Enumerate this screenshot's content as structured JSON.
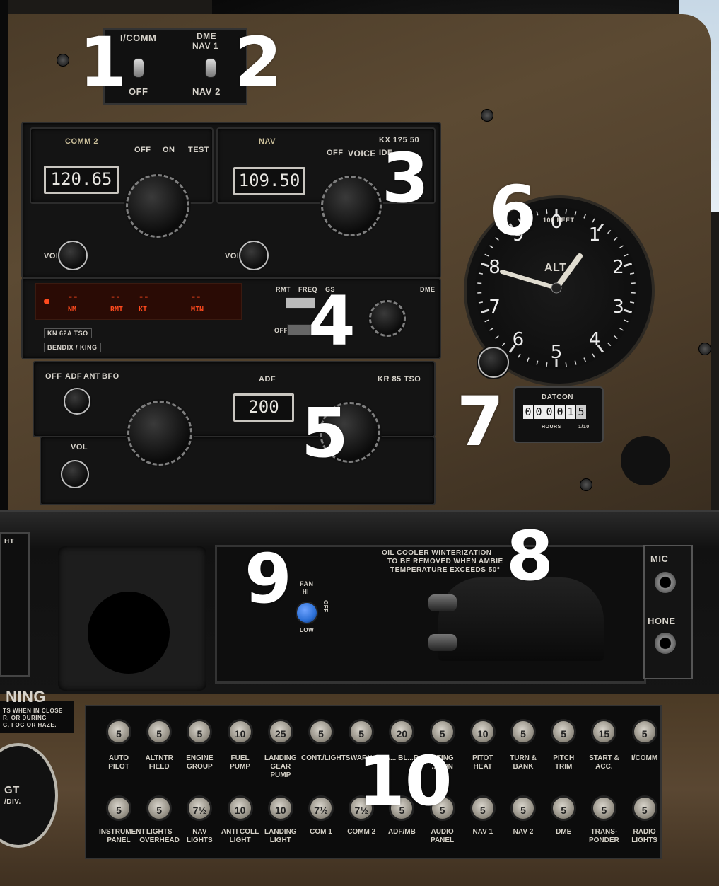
{
  "callouts": [
    "1",
    "2",
    "3",
    "4",
    "5",
    "6",
    "7",
    "8",
    "9",
    "10"
  ],
  "switch_plate": {
    "left_top": "I/COMM",
    "left_bottom": "OFF",
    "right_top1": "DME",
    "right_top2": "NAV 1",
    "right_bottom": "NAV 2"
  },
  "radio_kx": {
    "comm_label": "COMM 2",
    "comm_freq": "120.65",
    "nav_label": "NAV",
    "nav_freq": "109.50",
    "sw_off": "OFF",
    "sw_on": "ON",
    "sw_test": "TEST",
    "nav_off": "OFF",
    "nav_voice": "VOICE",
    "nav_ident": "IDE",
    "model": "KX 1?5 50",
    "vol1": "VOL",
    "vol2": "VOL"
  },
  "dme": {
    "seg1": "--",
    "seg2": "--",
    "seg3": "--",
    "seg4": "--",
    "u1": "NM",
    "u2": "RMT",
    "u3": "KT",
    "u4": "MIN",
    "rmt": "RMT",
    "freq": "FREQ",
    "gs": "GS",
    "title": "DME",
    "off": "OFF",
    "model": "KN 62A TSO",
    "brand": "BENDIX / KING"
  },
  "adf": {
    "modes_off": "OFF",
    "modes_adf": "ADF",
    "modes_ant": "ANT",
    "modes_bfo": "BFO",
    "title": "ADF",
    "freq": "200",
    "model": "KR 85 TSO",
    "vol": "VOL"
  },
  "altimeter": {
    "label": "ALT",
    "feet": "100 FEET",
    "nums": [
      "0",
      "1",
      "2",
      "3",
      "4",
      "5",
      "6",
      "7",
      "8",
      "9"
    ]
  },
  "hobbs": {
    "brand": "DATCON",
    "digits": [
      "0",
      "0",
      "0",
      "0",
      "1",
      "5"
    ],
    "hours": "HOURS",
    "tenths": "1/10"
  },
  "oil_cooler": {
    "line1": "OIL COOLER WINTERIZATION",
    "line2": "TO BE REMOVED WHEN AMBIE",
    "line3": "TEMPERATURE EXCEEDS 50°"
  },
  "fan": {
    "fan": "FAN",
    "hi": "HI",
    "low": "LOW",
    "off": "OFF"
  },
  "jacks": {
    "mic": "MIC",
    "phone": "HONE"
  },
  "warning": {
    "title": "NING",
    "line1": "TS WHEN IN CLOSE",
    "line2": "R, OR DURING",
    "line3": "G, FOG OR HAZE."
  },
  "egt": {
    "label": "GT",
    "sub": "/DIV."
  },
  "left_tag": "HT",
  "breakers_row1": [
    {
      "v": "5",
      "label": "AUTO PILOT"
    },
    {
      "v": "5",
      "label": "ALTNTR FIELD"
    },
    {
      "v": "5",
      "label": "ENGINE GROUP"
    },
    {
      "v": "10",
      "label": "FUEL PUMP"
    },
    {
      "v": "25",
      "label": "LANDING GEAR PUMP"
    },
    {
      "v": "5",
      "label": "CONT./LIGHTS"
    },
    {
      "v": "5",
      "label": "WARN"
    },
    {
      "v": "20",
      "label": "A... BL...R"
    },
    {
      "v": "5",
      "label": "...TING ...CON"
    },
    {
      "v": "10",
      "label": "PITOT HEAT"
    },
    {
      "v": "5",
      "label": "TURN & BANK"
    },
    {
      "v": "5",
      "label": "PITCH TRIM"
    },
    {
      "v": "15",
      "label": "START & ACC."
    },
    {
      "v": "5",
      "label": "I/COMM"
    }
  ],
  "breakers_row2": [
    {
      "v": "5",
      "label": "INSTRUMENT PANEL"
    },
    {
      "v": "5",
      "label": "LIGHTS OVERHEAD"
    },
    {
      "v": "7½",
      "label": "NAV LIGHTS"
    },
    {
      "v": "10",
      "label": "ANTI COLL LIGHT"
    },
    {
      "v": "10",
      "label": "LANDING LIGHT"
    },
    {
      "v": "7½",
      "label": "COM 1"
    },
    {
      "v": "7½",
      "label": "COMM 2"
    },
    {
      "v": "5",
      "label": "ADF/MB"
    },
    {
      "v": "5",
      "label": "AUDIO PANEL"
    },
    {
      "v": "5",
      "label": "NAV 1"
    },
    {
      "v": "5",
      "label": "NAV 2"
    },
    {
      "v": "5",
      "label": "DME"
    },
    {
      "v": "5",
      "label": "TRANS-PONDER"
    },
    {
      "v": "5",
      "label": "RADIO LIGHTS"
    }
  ],
  "colors": {
    "panel": "#5c4a33",
    "dme_led": "#ff4a1e",
    "fan_knob": "#2b6fd6"
  }
}
